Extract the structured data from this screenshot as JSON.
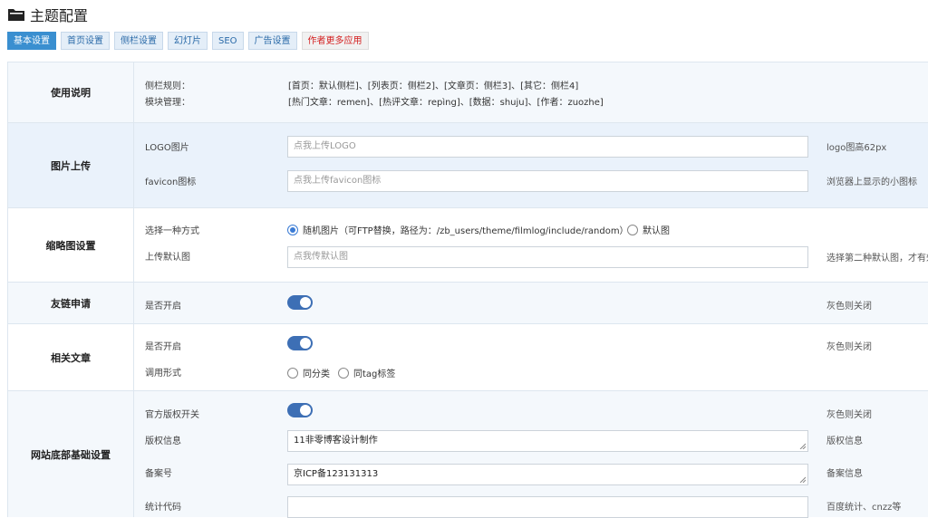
{
  "header": {
    "title": "主题配置"
  },
  "tabs": [
    {
      "label": "基本设置"
    },
    {
      "label": "首页设置"
    },
    {
      "label": "侧栏设置"
    },
    {
      "label": "幻灯片"
    },
    {
      "label": "SEO"
    },
    {
      "label": "广告设置"
    },
    {
      "label": "作者更多应用"
    }
  ],
  "usage": {
    "label": "使用说明",
    "line1_label": "侧栏规则：",
    "line1_text": "[首页：默认侧栏]、[列表页：侧栏2]、[文章页：侧栏3]、[其它：侧栏4]",
    "line2_label": "模块管理：",
    "line2_text": "[热门文章：remen]、[热评文章：repìng]、[数据：shuju]、[作者：zuozhe]"
  },
  "image_upload": {
    "label": "图片上传",
    "logo_label": "LOGO图片",
    "logo_placeholder": "点我上传LOGO",
    "logo_note": "logo图高62px",
    "favicon_label": "favicon图标",
    "favicon_placeholder": "点我上传favicon图标",
    "favicon_note": "浏览器上显示的小图标"
  },
  "thumbnail": {
    "label": "缩略图设置",
    "method_label": "选择一种方式",
    "option_random": "随机图片（可FTP替换，路径为：/zb_users/theme/filmlog/include/random）",
    "option_default": "默认图",
    "upload_label": "上传默认图",
    "upload_placeholder": "点我传默认图",
    "note": "选择第二种默认图，才有效。"
  },
  "friend_links": {
    "label": "友链申请",
    "enable_label": "是否开启",
    "note": "灰色则关闭"
  },
  "related": {
    "label": "相关文章",
    "enable_label": "是否开启",
    "note": "灰色则关闭",
    "call_label": "调用形式",
    "option_category": "同分类",
    "option_tag": "同tag标签"
  },
  "footer_settings": {
    "label": "网站底部基础设置",
    "copyright_switch_label": "官方版权开关",
    "copyright_switch_note": "灰色则关闭",
    "copyright_info_label": "版权信息",
    "copyright_info_value": "11非零博客设计制作",
    "copyright_info_note": "版权信息",
    "icp_label": "备案号",
    "icp_value": "京ICP备123131313",
    "icp_note": "备案信息",
    "stats_label": "统计代码",
    "stats_value": "",
    "stats_note": "百度统计、cnzz等"
  }
}
